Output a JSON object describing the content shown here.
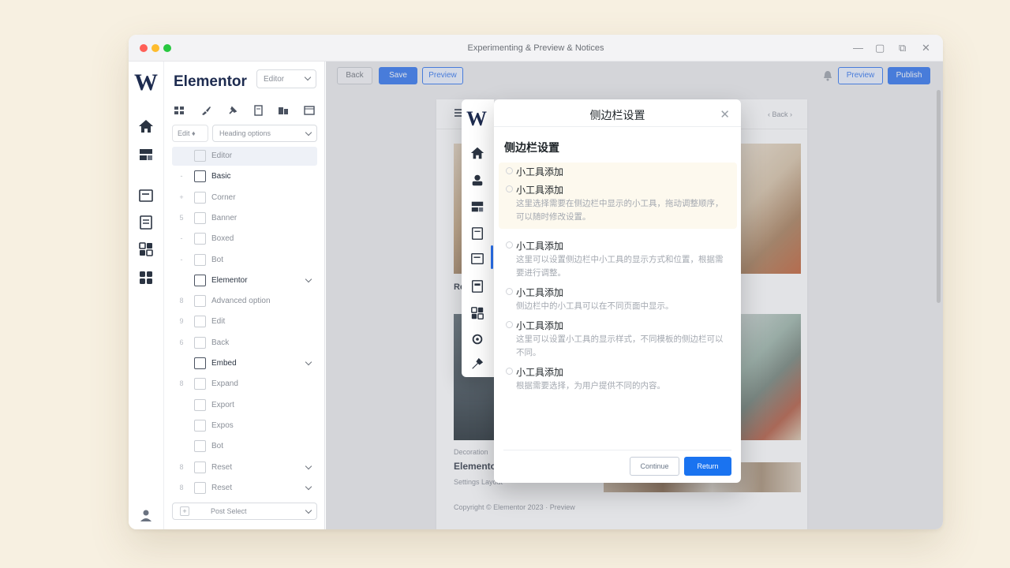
{
  "window": {
    "title": "Experimenting & Preview & Notices"
  },
  "rail": {
    "logo": "W",
    "icons": [
      "home-icon",
      "layout-icon",
      "media-icon",
      "document-icon",
      "widgets-icon",
      "grid-icon",
      "user-icon"
    ]
  },
  "panel": {
    "title": "Elementor",
    "select_value": "Editor",
    "toolbar_icons": [
      "grid-tool-icon",
      "brush-tool-icon",
      "pin-tool-icon",
      "page-tool-icon",
      "layers-tool-icon",
      "window-tool-icon"
    ],
    "filter_chip": "Edit",
    "filter_select": "Heading options",
    "items": [
      {
        "idx": "",
        "label": "Editor",
        "dark": false,
        "chevron": false,
        "active": true
      },
      {
        "idx": "-",
        "label": "Basic",
        "dark": true,
        "chevron": false,
        "active": false
      },
      {
        "idx": "+",
        "label": "Corner",
        "dark": false,
        "chevron": false,
        "active": false
      },
      {
        "idx": "5",
        "label": "Banner",
        "dark": false,
        "chevron": false,
        "active": false
      },
      {
        "idx": "-",
        "label": "Boxed",
        "dark": false,
        "chevron": false,
        "active": false
      },
      {
        "idx": "-",
        "label": "Bot",
        "dark": false,
        "chevron": false,
        "active": false
      },
      {
        "idx": "",
        "label": "Elementor",
        "dark": true,
        "chevron": true,
        "active": false
      },
      {
        "idx": "8",
        "label": "Advanced option",
        "dark": false,
        "chevron": false,
        "active": false
      },
      {
        "idx": "9",
        "label": "Edit",
        "dark": false,
        "chevron": false,
        "active": false
      },
      {
        "idx": "6",
        "label": "Back",
        "dark": false,
        "chevron": false,
        "active": false
      },
      {
        "idx": "",
        "label": "Embed",
        "dark": true,
        "chevron": true,
        "active": false
      },
      {
        "idx": "8",
        "label": "Expand",
        "dark": false,
        "chevron": false,
        "active": false
      },
      {
        "idx": "",
        "label": "Export",
        "dark": false,
        "chevron": false,
        "active": false
      },
      {
        "idx": "",
        "label": "Expos",
        "dark": false,
        "chevron": false,
        "active": false
      },
      {
        "idx": "",
        "label": "Bot",
        "dark": false,
        "chevron": false,
        "active": false
      },
      {
        "idx": "8",
        "label": "Reset",
        "dark": false,
        "chevron": true,
        "active": false
      },
      {
        "idx": "8",
        "label": "Reset",
        "dark": false,
        "chevron": true,
        "active": false
      }
    ],
    "footer": "Post Select"
  },
  "toolbar": {
    "btn_back": "Back",
    "btn_save": "Save",
    "btn_preview": "Preview",
    "btn_preview_right": "Preview",
    "btn_publish": "Publish"
  },
  "page": {
    "nav_text": "‹ Back ›",
    "mid_label": "Re",
    "caption_small": "Decoration",
    "caption_title": "Elementor",
    "caption_sub": "Settings Layout",
    "footer_text": "Copyright © Elementor 2023 · Preview"
  },
  "modal": {
    "title": "侧边栏设置",
    "section_title": "侧边栏设置",
    "options": [
      {
        "title": "小工具添加",
        "desc": ""
      },
      {
        "title": "小工具添加",
        "desc": "这里选择需要在侧边栏中显示的小工具，拖动调整顺序，可以随时修改设置。"
      },
      {
        "title": "小工具添加",
        "desc": "这里可以设置侧边栏中小工具的显示方式和位置，根据需要进行调整。"
      },
      {
        "title": "小工具添加",
        "desc": "侧边栏中的小工具可以在不同页面中显示。"
      },
      {
        "title": "小工具添加",
        "desc": "这里可以设置小工具的显示样式，不同模板的侧边栏可以不同。"
      },
      {
        "title": "小工具添加",
        "desc": "根据需要选择，为用户提供不同的内容。"
      }
    ],
    "cancel": "Continue",
    "confirm": "Return"
  },
  "colors": {
    "accent": "#2a71ef",
    "brand": "#1d2b4f",
    "background": "#f7f0e1"
  }
}
